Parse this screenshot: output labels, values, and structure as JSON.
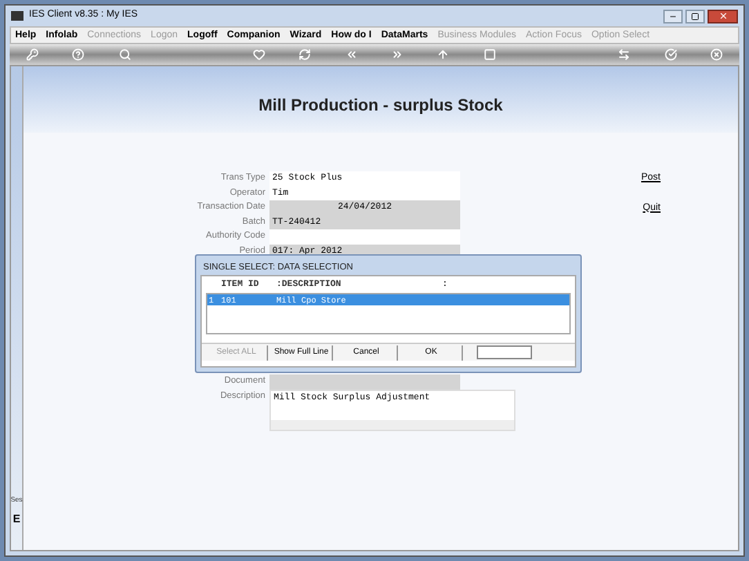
{
  "window": {
    "title": "IES Client v8.35 : My IES"
  },
  "menu": [
    {
      "label": "Help",
      "disabled": false
    },
    {
      "label": "Infolab",
      "disabled": false
    },
    {
      "label": "Connections",
      "disabled": true
    },
    {
      "label": "Logon",
      "disabled": true
    },
    {
      "label": "Logoff",
      "disabled": false
    },
    {
      "label": "Companion",
      "disabled": false
    },
    {
      "label": "Wizard",
      "disabled": false
    },
    {
      "label": "How do I",
      "disabled": false
    },
    {
      "label": "DataMarts",
      "disabled": false
    },
    {
      "label": "Business Modules",
      "disabled": true
    },
    {
      "label": "Action Focus",
      "disabled": true
    },
    {
      "label": "Option Select",
      "disabled": true
    }
  ],
  "page_title": "Mill Production - surplus Stock",
  "form": [
    {
      "label": "Trans Type",
      "value": "25 Stock Plus",
      "readonly": false
    },
    {
      "label": "Operator",
      "value": "Tim",
      "readonly": false
    },
    {
      "label": "Transaction Date",
      "value": "24/04/2012",
      "readonly": true
    },
    {
      "label": "Batch",
      "value": "TT-240412",
      "readonly": true
    },
    {
      "label": "Authority Code",
      "readonly": false
    },
    {
      "label": "Period",
      "value": "017: Apr 2012",
      "readonly": true
    }
  ],
  "links": [
    "Post",
    "Quit"
  ],
  "dialog": {
    "title": "SINGLE SELECT: DATA SELECTION",
    "columns": [
      "",
      "ITEM ID",
      ":DESCRIPTION",
      ":"
    ],
    "rows": [
      {
        "cells": [
          "1",
          "101",
          "Mill Cpo Store"
        ],
        "selected": true
      }
    ],
    "buttons": [
      {
        "label": "Select ALL",
        "disabled": true
      },
      {
        "label": "Show Full Line",
        "disabled": false
      },
      {
        "label": "Cancel",
        "disabled": false
      },
      {
        "label": "OK",
        "disabled": false
      }
    ]
  },
  "document_label": "Document",
  "description": {
    "label": "Description",
    "value": "Mill Stock Surplus Adjustment"
  },
  "side_panel": {
    "label": "Ses",
    "glyph": "E"
  }
}
